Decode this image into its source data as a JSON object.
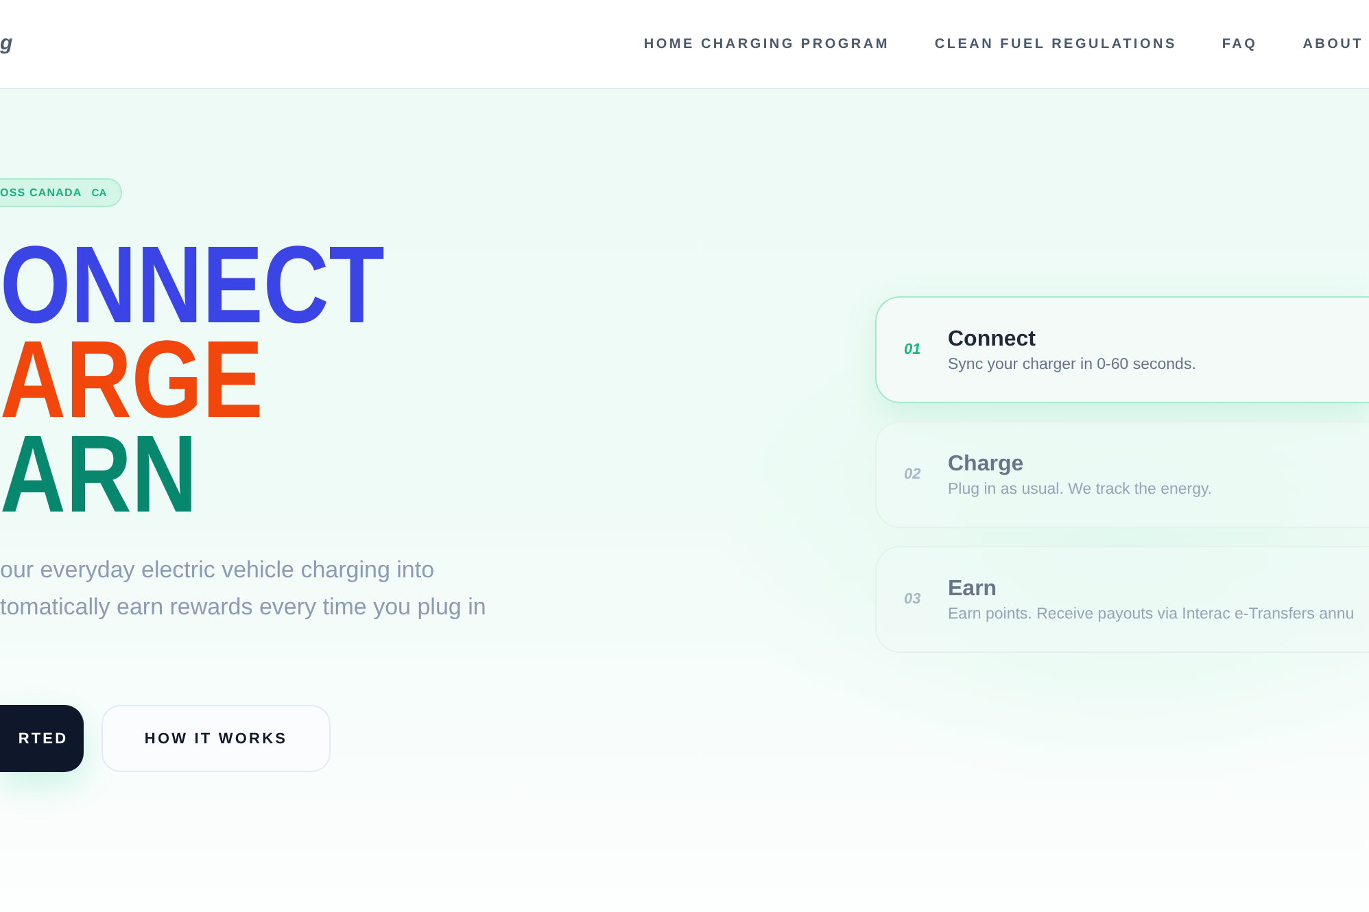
{
  "header": {
    "logo": "g",
    "nav": [
      {
        "label": "HOME CHARGING PROGRAM"
      },
      {
        "label": "CLEAN FUEL REGULATIONS"
      },
      {
        "label": "FAQ"
      },
      {
        "label": "ABOUT"
      }
    ]
  },
  "hero": {
    "badge": {
      "text": "OSS CANADA",
      "country": "CA"
    },
    "headline": [
      {
        "text": "ONNECT",
        "color": "#3b45e6"
      },
      {
        "text": "ARGE",
        "color": "#f1470d"
      },
      {
        "text": "ARN",
        "color": "#08876f"
      }
    ],
    "description_lines": [
      "our everyday electric vehicle charging into",
      "tomatically earn rewards every time you plug in"
    ],
    "buttons": [
      {
        "label": "RTED",
        "kind": "primary"
      },
      {
        "label": "HOW IT WORKS",
        "kind": "secondary"
      }
    ]
  },
  "steps": [
    {
      "number": "01",
      "title": "Connect",
      "description": "Sync your charger in 0-60 seconds.",
      "selected": true
    },
    {
      "number": "02",
      "title": "Charge",
      "description": "Plug in as usual. We track the energy.",
      "selected": false
    },
    {
      "number": "03",
      "title": "Earn",
      "description": "Earn points. Receive payouts via Interac e-Transfers annu",
      "selected": false
    }
  ]
}
